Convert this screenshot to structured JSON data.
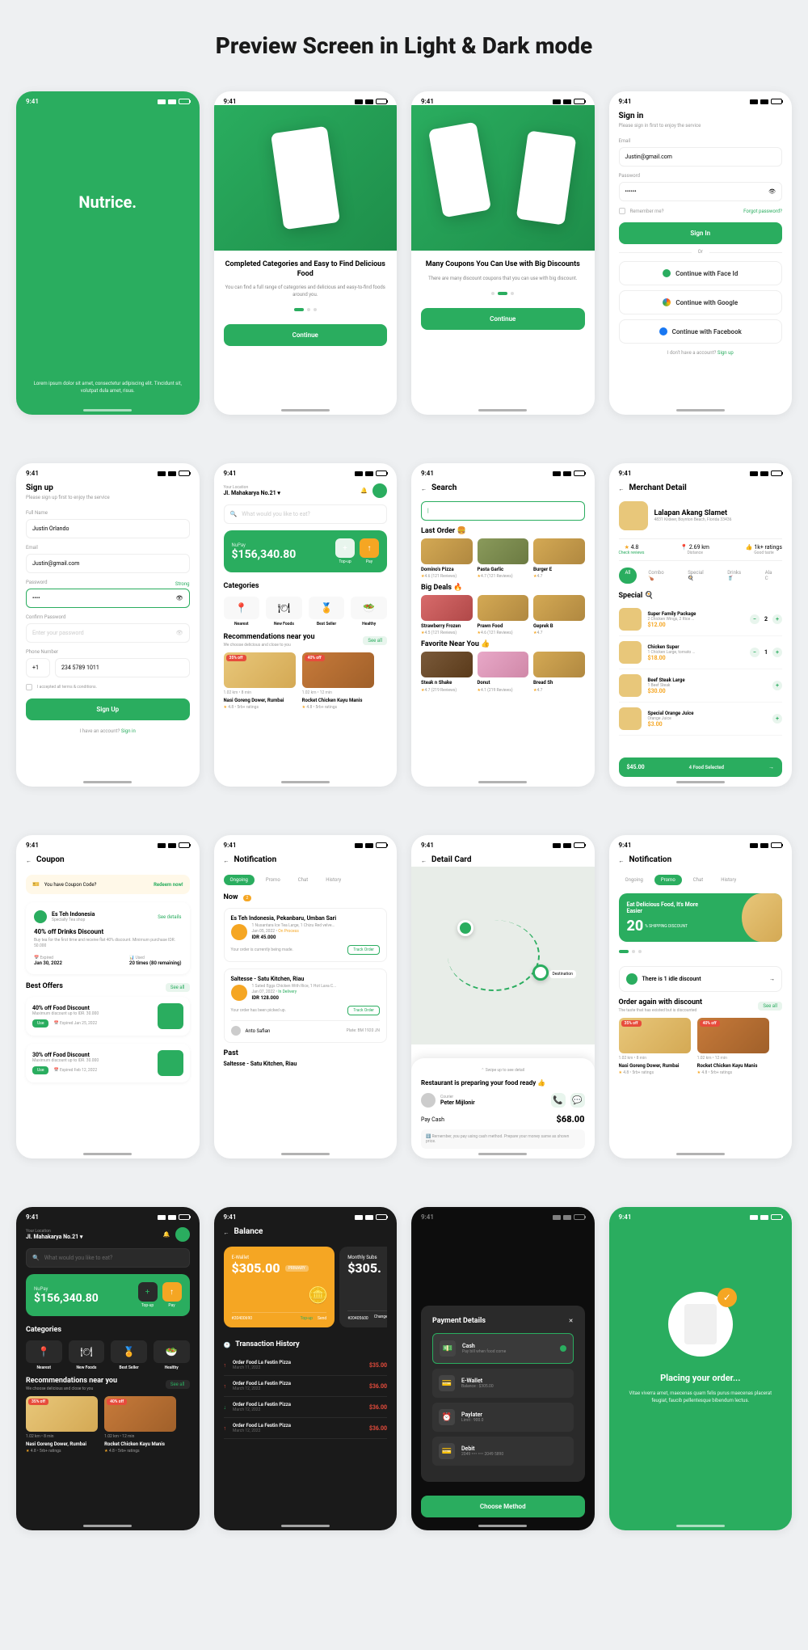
{
  "page_title": "Preview Screen in Light & Dark mode",
  "status": {
    "time": "9:41"
  },
  "splash": {
    "logo": "Nutrice.",
    "text": "Lorem ipsum dolor sit amet, consectetur adipiscing elit. Tincidunt sit, volutpat dula amet, risus."
  },
  "onboard1": {
    "title": "Completed Categories and Easy to Find Delicious Food",
    "desc": "You can find a full range of categories and delicious and easy-to-find foods around you.",
    "btn": "Continue"
  },
  "onboard2": {
    "title": "Many Coupons You Can Use with Big Discounts",
    "desc": "There are many discount coupons that you can use with big discount.",
    "btn": "Continue"
  },
  "signin": {
    "title": "Sign in",
    "sub": "Please sign in first to enjoy the service",
    "email_label": "Email",
    "email": "Justin@gmail.com",
    "password_label": "Password",
    "password": "••••••",
    "remember": "Remember me?",
    "forgot": "Forgot password?",
    "btn": "Sign In",
    "or": "Or",
    "faceid": "Continue with Face Id",
    "google": "Continue with Google",
    "facebook": "Continue with Facebook",
    "no_account": "I don't have a account? ",
    "signup_link": "Sign up"
  },
  "signup": {
    "title": "Sign up",
    "sub": "Please sign up first to enjoy the service",
    "name_label": "Full Name",
    "name": "Justin Orlando",
    "email_label": "Email",
    "email": "Justin@gmail.com",
    "password_label": "Password",
    "password": "••••",
    "strong": "Strong",
    "confirm_label": "Confirm Password",
    "confirm_placeholder": "Enter your password",
    "phone_label": "Phone Number",
    "phone_code": "+1",
    "phone": "234 5789 1011",
    "terms": "I accepted all terms & conditions.",
    "btn": "Sign Up",
    "have_account": "I have an account? ",
    "signin_link": "Sign in"
  },
  "home": {
    "location_label": "Your Location",
    "location": "Jl. Mahakarya No.21",
    "search_placeholder": "What would you like to eat?",
    "wallet_label": "NuPay",
    "balance": "$156,340.80",
    "topup": "Top-up",
    "pay": "Pay",
    "categories_title": "Categories",
    "cats": [
      "Nearest",
      "New Foods",
      "Best Seller",
      "Healthy"
    ],
    "rec_title": "Recommendations near you",
    "rec_sub": "We choose delicious and close to you",
    "see_all": "See all",
    "food1": {
      "badge": "35% off",
      "meta": "1.02 km • 8 min",
      "name": "Nasi Goreng Dower, Rumbai",
      "rating": "4.8 • 5rb+ ratings"
    },
    "food2": {
      "badge": "40% off",
      "meta": "1.02 km • 12 min",
      "name": "Rocket Chicken Kayu Manis",
      "rating": "4.8 • 5rb+ ratings"
    }
  },
  "search": {
    "title": "Search",
    "last_order": "Last Order 🍔",
    "big_deals": "Big Deals 🔥",
    "favorite": "Favorite Near You 👍",
    "items": [
      {
        "name": "Domino's Pizza",
        "rating": "4.6 (121 Reviews)"
      },
      {
        "name": "Pasta Garlic",
        "rating": "4.7 (121 Reviews)"
      },
      {
        "name": "Burger E",
        "rating": "4.7"
      },
      {
        "name": "Strawberry Frozen",
        "rating": "4.5 (121 Reviews)"
      },
      {
        "name": "Prawn Food",
        "rating": "4.6 (121 Reviews)"
      },
      {
        "name": "Geprek B",
        "rating": "4.7"
      },
      {
        "name": "Steak n Shake",
        "rating": "4.7 (219 Reviews)"
      },
      {
        "name": "Donut",
        "rating": "4.1 (219 Reviews)"
      },
      {
        "name": "Bread Sh",
        "rating": "4.7"
      }
    ]
  },
  "merchant": {
    "title": "Merchant Detail",
    "name": "Lalapan Akang Slamet",
    "address": "4831 Kildeer, Boynton Beach, Florida 33436",
    "rating": "4.8",
    "rating_label": "Check reviews",
    "distance": "2.69 km",
    "distance_label": "Distance",
    "quality": "1k+ ratings",
    "quality_label": "Good taste",
    "tabs": [
      "All",
      "Combo 🍗",
      "Special 🍳",
      "Drinks 🥤",
      "Ala C"
    ],
    "special_title": "Special 🍳",
    "items": [
      {
        "name": "Super Family Package",
        "desc": "2 Chicken Wings, 2 Rice ...",
        "price": "$12.00",
        "qty": "2"
      },
      {
        "name": "Chicken Super",
        "desc": "1 Chicken Large, tomato ...",
        "price": "$18.00",
        "qty": "1"
      },
      {
        "name": "Beef Steak Large",
        "desc": "1 Beef Steak",
        "price": "$30.00",
        "qty": ""
      },
      {
        "name": "Special Orange Juice",
        "desc": "Orange Juice",
        "price": "$3.00",
        "qty": ""
      }
    ],
    "cart_total": "$45.00",
    "cart_count": "4 Food Selected"
  },
  "coupon": {
    "title": "Coupon",
    "have_code": "You have Coupon Code?",
    "redeem": "Redeem now!",
    "es_teh": "Es Teh Indonesia",
    "es_teh_sub": "Specially Tea shop",
    "see_details": "See details",
    "coupon1_title": "40% off Drinks Discount",
    "coupon1_desc": "Buy tea for the first time and receive flat 40% discount. Minimum purchase IDR. 50.000",
    "expired_label": "Expired",
    "expired1": "Jan 30, 2022",
    "used_label": "Used",
    "used1": "20 times (80 remaining)",
    "best_offers": "Best Offers",
    "offer1": {
      "title": "40% off Food Discount",
      "desc": "Maximum discount up to IDR. 30.000",
      "expired": "Expired Jan 25, 2022"
    },
    "offer2": {
      "title": "30% off Food Discount",
      "desc": "Maximum discount up to IDR. 30.000",
      "expired": "Expired Feb 12, 2022"
    },
    "use_btn": "Use"
  },
  "notification": {
    "title": "Notification",
    "tabs": [
      "Ongoing",
      "Promo",
      "Chat",
      "History"
    ],
    "now": "Now",
    "now_badge": "2",
    "notifs": [
      {
        "merchant": "Es Teh Indonesia, Pekanbaru, Umban Sari",
        "order": "1 Nusantara Ice Tea Large, 1 Chizu Red velve...",
        "date": "Jan 05, 2022",
        "status": "On Process",
        "price": "IDR 45.000",
        "progress": "Your order is currently being made.",
        "btn": "Track Order"
      },
      {
        "merchant": "Saltesse - Satu Kitchen, Riau",
        "order": "1 Sated Eggs Chicken With Rice, 1 Hot Lava C...",
        "date": "Jan 07, 2022",
        "status": "In Delivery",
        "price": "IDR 128.000",
        "progress": "Your order has been picked up.",
        "btn": "Track Order",
        "driver": "Anto Safian",
        "plate": "Plate: BM 1920 JN"
      }
    ],
    "past": "Past",
    "past_merchant": "Saltesse - Satu Kitchen, Riau"
  },
  "detail_card": {
    "title": "Detail Card",
    "destination": "Destination",
    "swipe": "Swipe up to see detail",
    "prep_title": "Restaurant is preparing your food ready 👍",
    "courier_label": "Courier",
    "courier": "Peter Mijlonir",
    "pay_label": "Pay Cash",
    "amount": "$68.00",
    "reminder": "Remember, you pay using cash method. Prepare your money same as shown price."
  },
  "promo_notif": {
    "title": "Notification",
    "tabs": [
      "Ongoing",
      "Promo",
      "Chat",
      "History"
    ],
    "banner_title": "Eat Delicious Food, It's More Easier",
    "banner_discount": "20",
    "banner_suffix": "% SHIPPING DISCOUNT",
    "idle": "There is 1 idle discount",
    "order_again": "Order again with discount",
    "order_sub": "The taste that has existed but is discounted",
    "see_all": "See all"
  },
  "balance_screen": {
    "title": "Balance",
    "ewallet": "E-Wallet",
    "amount": "$305.00",
    "primary": "PRIMARY",
    "card2_amount": "$305.",
    "card2_label": "Monthly Subs",
    "card_num": "#20400690",
    "card_num2": "#20405600",
    "topup": "Top-up",
    "send": "Send",
    "change": "Change Colo",
    "txn_title": "Transaction History",
    "txns": [
      {
        "name": "Order Food La Festin Pizza",
        "date": "March 11, 2022",
        "amount": "$35.00"
      },
      {
        "name": "Order Food La Festin Pizza",
        "date": "March 12, 2022",
        "amount": "$36.00"
      },
      {
        "name": "Order Food La Festin Pizza",
        "date": "March 12, 2022",
        "amount": "$36.00"
      },
      {
        "name": "Order Food La Festin Pizza",
        "date": "March 12, 2022",
        "amount": "$36.00"
      }
    ]
  },
  "payment": {
    "title": "Payment Details",
    "options": [
      {
        "name": "Cash",
        "desc": "Pay bill when food come"
      },
      {
        "name": "E-Wallet",
        "desc": "Balance : $305.00"
      },
      {
        "name": "Paylater",
        "desc": "Limit : 900.0"
      },
      {
        "name": "Debit",
        "desc": "2049 •••• •••• 2049 5890"
      }
    ],
    "btn": "Choose Method"
  },
  "placing": {
    "title": "Placing your order...",
    "desc": "Vitae viverra amet, maecenas quam felis purus maecenas placerat feugiat, faucib pellentesque bibendum lectus."
  }
}
